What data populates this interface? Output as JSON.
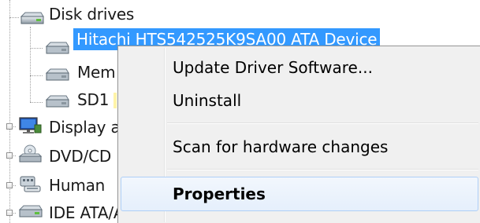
{
  "device_tree": {
    "category_disk": {
      "label": "Disk drives",
      "icon": "disk-drive-icon"
    },
    "disk_children": [
      {
        "label": "Hitachi HTS542525K9SA00 ATA Device",
        "icon": "hard-disk-icon",
        "selected": true
      },
      {
        "label": "Mem",
        "icon": "hard-disk-icon",
        "selected": false
      },
      {
        "label": "SD1",
        "icon": "hard-disk-icon",
        "selected": false
      }
    ],
    "other_categories": [
      {
        "label": "Display a",
        "icon": "display-adapter-icon"
      },
      {
        "label": "DVD/CD",
        "icon": "dvd-drive-icon"
      },
      {
        "label": "Human",
        "icon": "human-interface-device-icon"
      },
      {
        "label": "IDE ATA/ATAPI controllers",
        "icon": "ide-controller-icon"
      }
    ]
  },
  "context_menu": {
    "items": [
      {
        "label": "Update Driver Software...",
        "bold": false,
        "highlighted": false
      },
      {
        "label": "Uninstall",
        "bold": false,
        "highlighted": false
      },
      {
        "label": "Scan for hardware changes",
        "bold": false,
        "highlighted": false
      },
      {
        "label": "Properties",
        "bold": true,
        "highlighted": true
      }
    ]
  },
  "colors": {
    "selection": "#3399ff",
    "menu_background": "#f0f0f0",
    "menu_highlight_border": "#aecff7"
  }
}
